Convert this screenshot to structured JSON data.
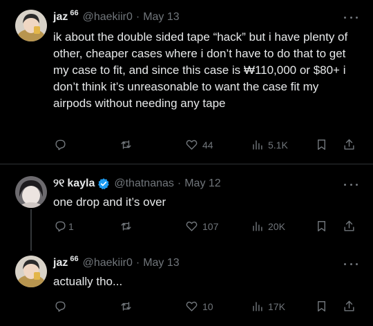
{
  "tweets": [
    {
      "name": "jaz",
      "badge": "66",
      "handle": "@haekiir0",
      "dot": "·",
      "date": "May 13",
      "text": "ik about the double sided tape “hack” but i have plenty of other, cheaper cases where i don’t have to do that to get my case to fit, and since this case is ₩110,000 or $80+ i don’t think it’s unreasonable to want the case fit my airpods without needing any tape",
      "replies": "",
      "retweets": "",
      "likes": "44",
      "views": "5.1K"
    },
    {
      "name_prefix": "୨୧",
      "name": "kayla",
      "handle": "@thatnanas",
      "dot": "·",
      "date": "May 12",
      "text": "one drop and it’s over",
      "replies": "1",
      "retweets": "",
      "likes": "107",
      "views": "20K"
    },
    {
      "name": "jaz",
      "badge": "66",
      "handle": "@haekiir0",
      "dot": "·",
      "date": "May 13",
      "text": "actually tho...",
      "replies": "",
      "retweets": "",
      "likes": "10",
      "views": "17K"
    }
  ],
  "colors": {
    "background": "#000000",
    "text": "#e7e9ea",
    "muted": "#71767b",
    "verified": "#1d9bf0",
    "separator": "#2f3336"
  }
}
